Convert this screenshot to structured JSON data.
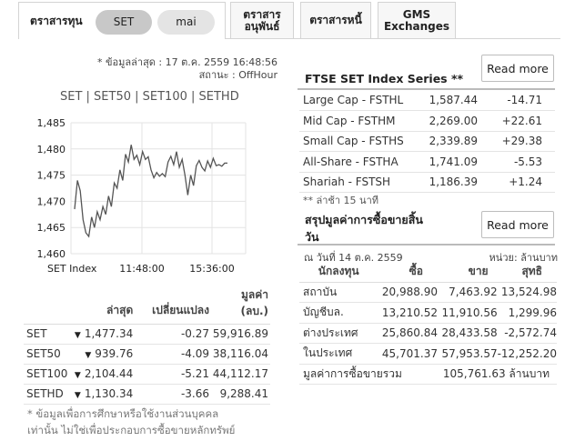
{
  "tabs": {
    "main_label": "ตราสารทุน",
    "pill_set": "SET",
    "pill_mai": "mai",
    "derivatives_line1": "ตราสาร",
    "derivatives_line2": "อนุพันธ์",
    "bonds": "ตราสารหนี้",
    "gms_line1": "GMS",
    "gms_line2": "Exchanges"
  },
  "update": {
    "last_update": "* ข้อมูลล่าสุด : 17 ต.ค. 2559 16:48:56",
    "status": "สถานะ : OffHour"
  },
  "index_links": "SET | SET50 | SET100 | SETHD",
  "chart_data": {
    "type": "line",
    "title": "",
    "xlabel": "",
    "ylabel": "",
    "ylim": [
      1460,
      1485
    ],
    "yticks": [
      "1,485",
      "1,480",
      "1,475",
      "1,470",
      "1,465",
      "1,460"
    ],
    "ytick_values": [
      1485,
      1480,
      1475,
      1470,
      1465,
      1460
    ],
    "xticks": [
      "SET Index",
      "11:48:00",
      "15:36:00"
    ],
    "grid": true,
    "color": "#555555",
    "series": [
      {
        "values": [
          1468.5,
          1474.0,
          1472.0,
          1466.5,
          1464.0,
          1463.3,
          1467.0,
          1465.0,
          1468.0,
          1466.5,
          1469.0,
          1467.5,
          1471.0,
          1469.0,
          1473.5,
          1472.5,
          1476.0,
          1474.0,
          1479.0,
          1477.5,
          1480.8,
          1478.0,
          1478.8,
          1477.0,
          1479.5,
          1478.0,
          1478.5,
          1476.0,
          1474.5,
          1475.5,
          1474.8,
          1475.3,
          1474.7,
          1477.5,
          1478.6,
          1477.0,
          1479.5,
          1476.5,
          1478.0,
          1475.0,
          1471.2,
          1475.0,
          1473.0,
          1476.8,
          1477.8,
          1476.5,
          1475.8,
          1477.7,
          1476.5,
          1478.2,
          1476.8,
          1477.0,
          1476.7,
          1477.3,
          1477.3
        ]
      }
    ]
  },
  "index_table": {
    "headers": {
      "last": "ล่าสุด",
      "change": "เปลี่ยนแปลง",
      "value_line1": "มูลค่า",
      "value_line2": "(ลบ.)"
    },
    "rows": [
      {
        "name": "SET",
        "last": "1,477.34",
        "change": "-0.27",
        "value": "59,916.89"
      },
      {
        "name": "SET50",
        "last": "939.76",
        "change": "-4.09",
        "value": "38,116.04"
      },
      {
        "name": "SET100",
        "last": "2,104.44",
        "change": "-5.21",
        "value": "44,112.17"
      },
      {
        "name": "SETHD",
        "last": "1,130.34",
        "change": "-3.66",
        "value": "9,288.41"
      }
    ]
  },
  "footnote": {
    "line1": "* ข้อมูลเพื่อการศึกษาหรือใช้งานส่วนบุคคล",
    "line2": "เท่านั้น ไม่ใช่เพื่อประกอบการซื้อขายหลักทรัพย์"
  },
  "ftse": {
    "title": "FTSE SET Index Series **",
    "read_more": "Read more",
    "rows": [
      {
        "name": "Large Cap - FSTHL",
        "value": "1,587.44",
        "change": "-14.71"
      },
      {
        "name": "Mid Cap - FSTHM",
        "value": "2,269.00",
        "change": "+22.61"
      },
      {
        "name": "Small Cap - FSTHS",
        "value": "2,339.89",
        "change": "+29.38"
      },
      {
        "name": "All-Share - FSTHA",
        "value": "1,741.09",
        "change": "-5.53"
      },
      {
        "name": "Shariah - FSTSH",
        "value": "1,186.39",
        "change": "+1.24"
      }
    ],
    "delay_note": "** ล่าช้า 15 นาที"
  },
  "summary": {
    "title_line1": "สรุปมูลค่าการซื้อขายสิ้น",
    "title_line2": "วัน",
    "read_more": "Read more",
    "as_of": "ณ วันที่ 14 ต.ค. 2559",
    "unit": "หน่วย: ล้านบาท",
    "headers": {
      "investor": "นักลงทุน",
      "buy": "ซื้อ",
      "sell": "ขาย",
      "net": "สุทธิ"
    },
    "rows": [
      {
        "name": "สถาบัน",
        "buy": "20,988.90",
        "sell": "7,463.92",
        "net": "13,524.98"
      },
      {
        "name": "บัญชีบล.",
        "buy": "13,210.52",
        "sell": "11,910.56",
        "net": "1,299.96"
      },
      {
        "name": "ต่างประเทศ",
        "buy": "25,860.84",
        "sell": "28,433.58",
        "net": "-2,572.74"
      },
      {
        "name": "ในประเทศ",
        "buy": "45,701.37",
        "sell": "57,953.57",
        "net": "-12,252.20"
      }
    ],
    "total_label": "มูลค่าการซื้อขายรวม",
    "total_value": "105,761.63 ล้านบาท"
  }
}
